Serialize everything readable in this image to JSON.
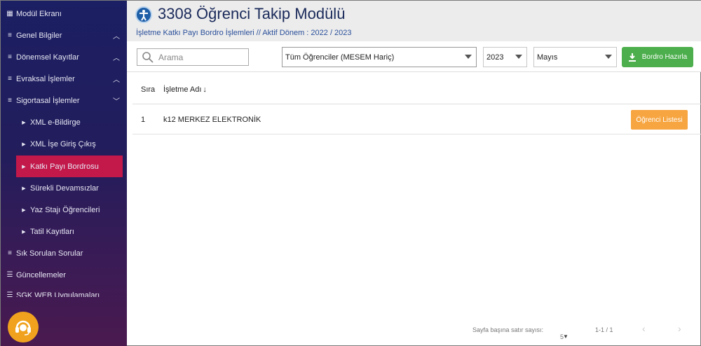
{
  "sidebar": {
    "items": [
      {
        "label": "Modül Ekranı",
        "icon": "grid-icon"
      },
      {
        "label": "Genel Bilgiler",
        "icon": "list-icon",
        "chevron": "up"
      },
      {
        "label": "Dönemsel Kayıtlar",
        "icon": "list-icon",
        "chevron": "up"
      },
      {
        "label": "Evraksal İşlemler",
        "icon": "list-icon",
        "chevron": "up"
      },
      {
        "label": "Sigortasal İşlemler",
        "icon": "list-icon",
        "chevron": "down"
      },
      {
        "label": "XML e-Bildirge",
        "sub": true
      },
      {
        "label": "XML İşe Giriş Çıkış",
        "sub": true
      },
      {
        "label": "Katkı Payı Bordrosu",
        "sub": true,
        "active": true
      },
      {
        "label": "Sürekli Devamsızlar",
        "sub": true
      },
      {
        "label": "Yaz Stajı Öğrencileri",
        "sub": true
      },
      {
        "label": "Tatil Kayıtları",
        "sub": true
      },
      {
        "label": "Sık Sorulan Sorular",
        "icon": "list-icon"
      },
      {
        "label": "Güncellemeler",
        "icon": "menu-icon"
      },
      {
        "label": "SGK WEB Uygulamaları",
        "icon": "menu-icon"
      }
    ]
  },
  "header": {
    "title": "3308 Öğrenci Takip Modülü",
    "subtitle": "İşletme Katkı Payı Bordro İşlemleri // Aktif Dönem : 2022 / 2023"
  },
  "toolbar": {
    "search_placeholder": "Arama",
    "filter_selected": "Tüm Öğrenciler (MESEM Hariç)",
    "year_selected": "2023",
    "month_selected": "Mayıs",
    "prepare_button": "Bordro Hazırla"
  },
  "table": {
    "headers": [
      "Sıra",
      "İşletme Adı"
    ],
    "rows": [
      {
        "no": "1",
        "name": "k12 MERKEZ ELEKTRONİK",
        "action": "Öğrenci Listesi"
      }
    ]
  },
  "pagination": {
    "rows_per_page_label": "Sayfa başına satır sayısı:",
    "rows_per_page": "5",
    "range": "1-1 / 1"
  },
  "colors": {
    "sidebar_top": "#1b1f63",
    "sidebar_bottom": "#4a1a4f",
    "active_item": "#c2184a",
    "green_button": "#4cae4c",
    "orange_button": "#f7a540",
    "support_button": "#f0a21e"
  }
}
